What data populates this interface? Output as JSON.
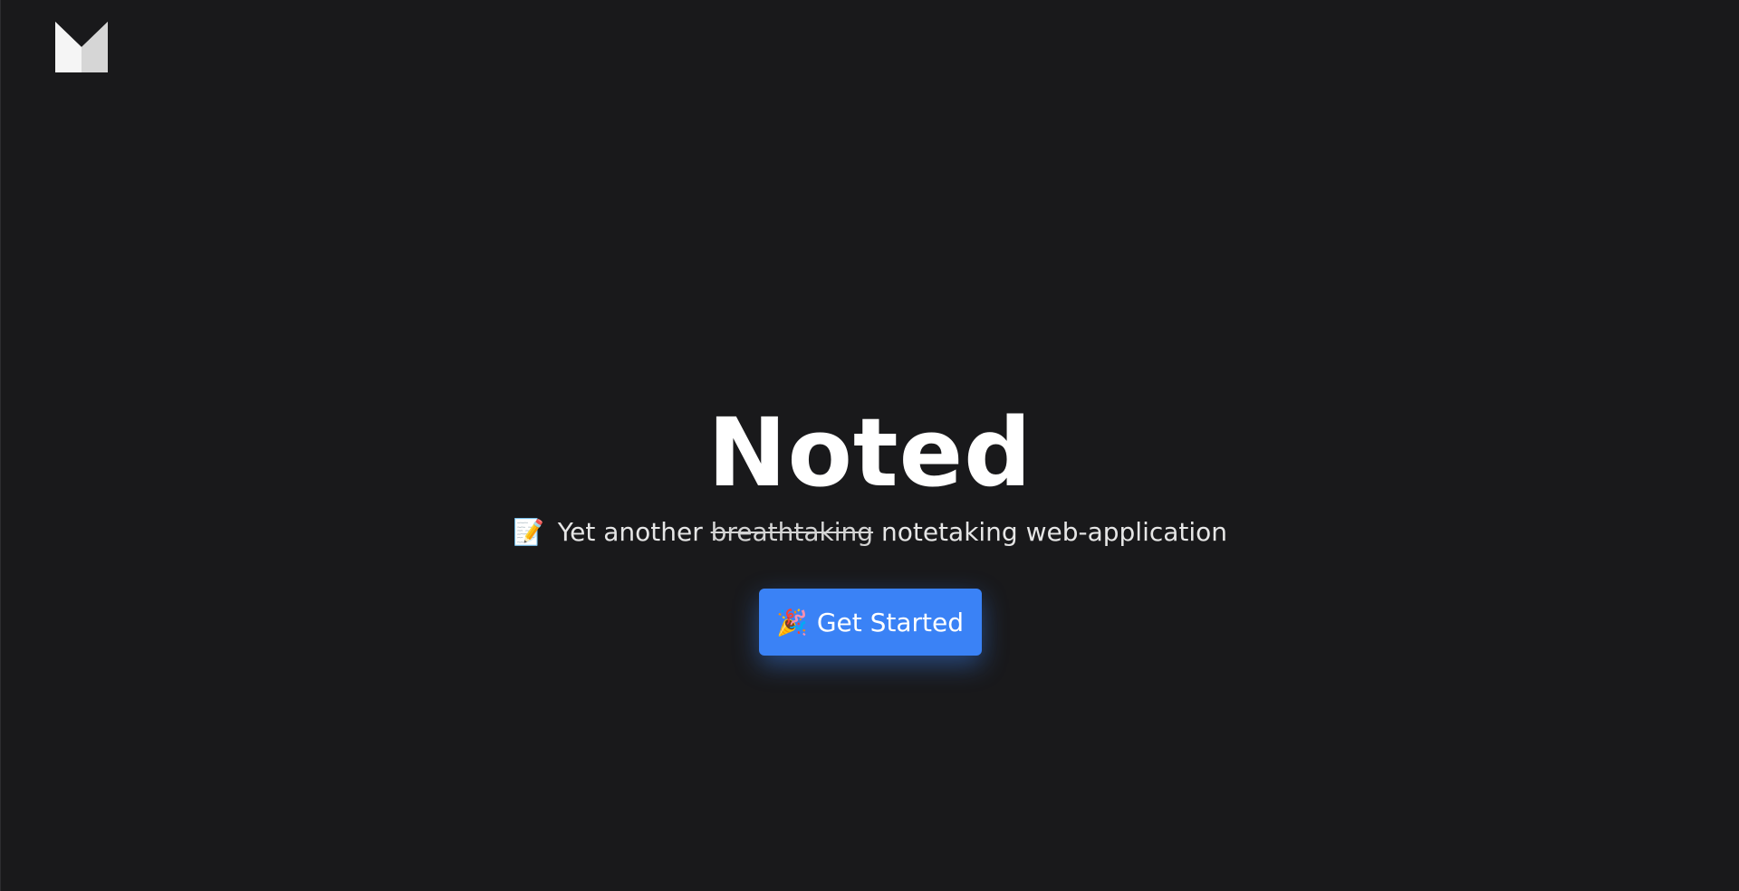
{
  "logo": {
    "icon": "m-logo-icon"
  },
  "hero": {
    "title": "Noted",
    "tagline": {
      "emoji": "📝",
      "prefix": "Yet another",
      "struck": "breathtaking",
      "suffix": "notetaking web-application"
    }
  },
  "cta": {
    "emoji": "🎉",
    "label": "Get Started"
  },
  "colors": {
    "background": "#19191b",
    "accent": "#3a82f6",
    "logo_light": "#ffffff",
    "logo_shade": "#d9d9d9"
  }
}
